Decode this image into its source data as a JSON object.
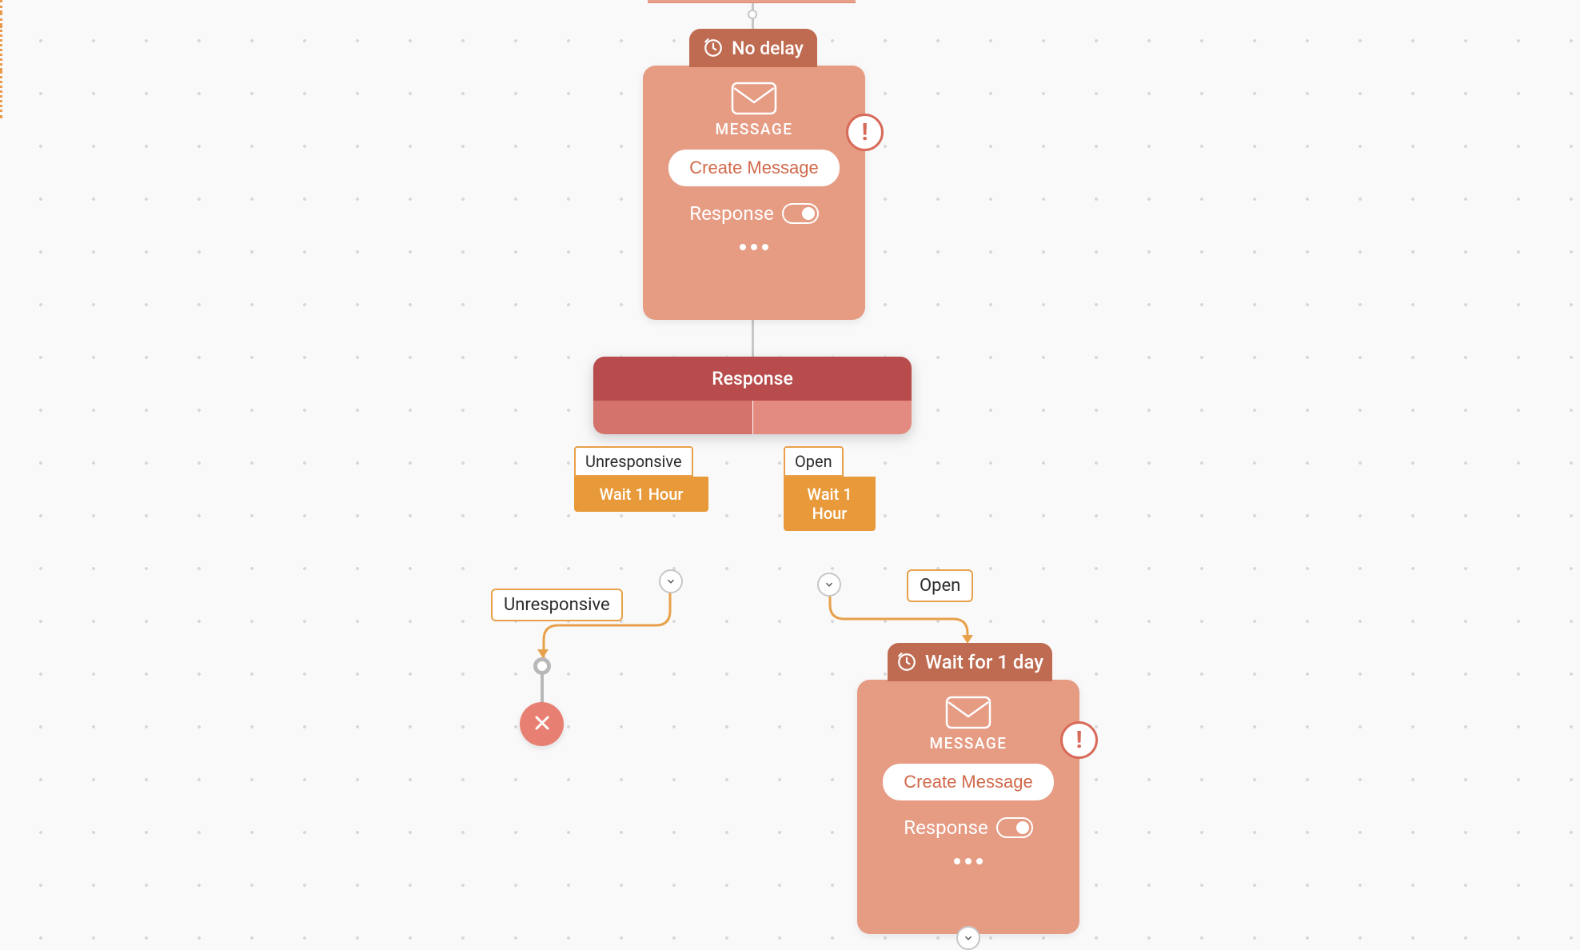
{
  "card1": {
    "delay_label": "No delay",
    "type_label": "MESSAGE",
    "button_label": "Create Message",
    "response_label": "Response"
  },
  "decision": {
    "label": "Response"
  },
  "branch_left": {
    "label": "Unresponsive",
    "wait_label": "Wait 1 Hour",
    "path_label": "Unresponsive"
  },
  "branch_right": {
    "label": "Open",
    "wait_label_line1": "Wait 1",
    "wait_label_line2": "Hour",
    "path_label": "Open"
  },
  "card2": {
    "delay_label": "Wait for 1 day",
    "type_label": "MESSAGE",
    "button_label": "Create Message",
    "response_label": "Response"
  },
  "icons": {
    "alert": "!",
    "more": "•••"
  },
  "colors": {
    "salmon": "#e69b83",
    "brick": "#bf6b51",
    "orange": "#e89a3a",
    "red_accent": "#d86a59",
    "pink": "#e87f73",
    "decision_top": "#b84c4c",
    "decision_bottom": "#d4736b"
  }
}
